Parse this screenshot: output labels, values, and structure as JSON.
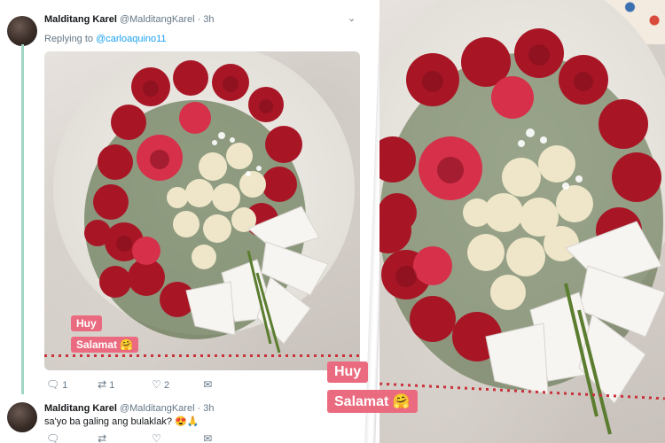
{
  "tweet1": {
    "name": "Malditang Karel",
    "handle": "@MalditangKarel",
    "time": "· 3h",
    "caret": "⌄",
    "replying_prefix": "Replying to ",
    "replying_handle": "@carloaquino11",
    "sticker_line1": "Huy",
    "sticker_line2": "Salamat 🤗",
    "actions": {
      "reply_count": "1",
      "retweet_count": "1",
      "like_count": "2"
    }
  },
  "tweet2": {
    "name": "Malditang Karel",
    "handle": "@MalditangKarel",
    "time": "· 3h",
    "text": "sa'yo ba galing ang bulaklak? 😍🙏"
  },
  "zoom": {
    "sticker_line1": "Huy",
    "sticker_line2": "Salamat 🤗"
  },
  "icons": {
    "reply": "reply-icon",
    "retweet": "retweet-icon",
    "like": "heart-icon",
    "dm": "envelope-icon"
  }
}
